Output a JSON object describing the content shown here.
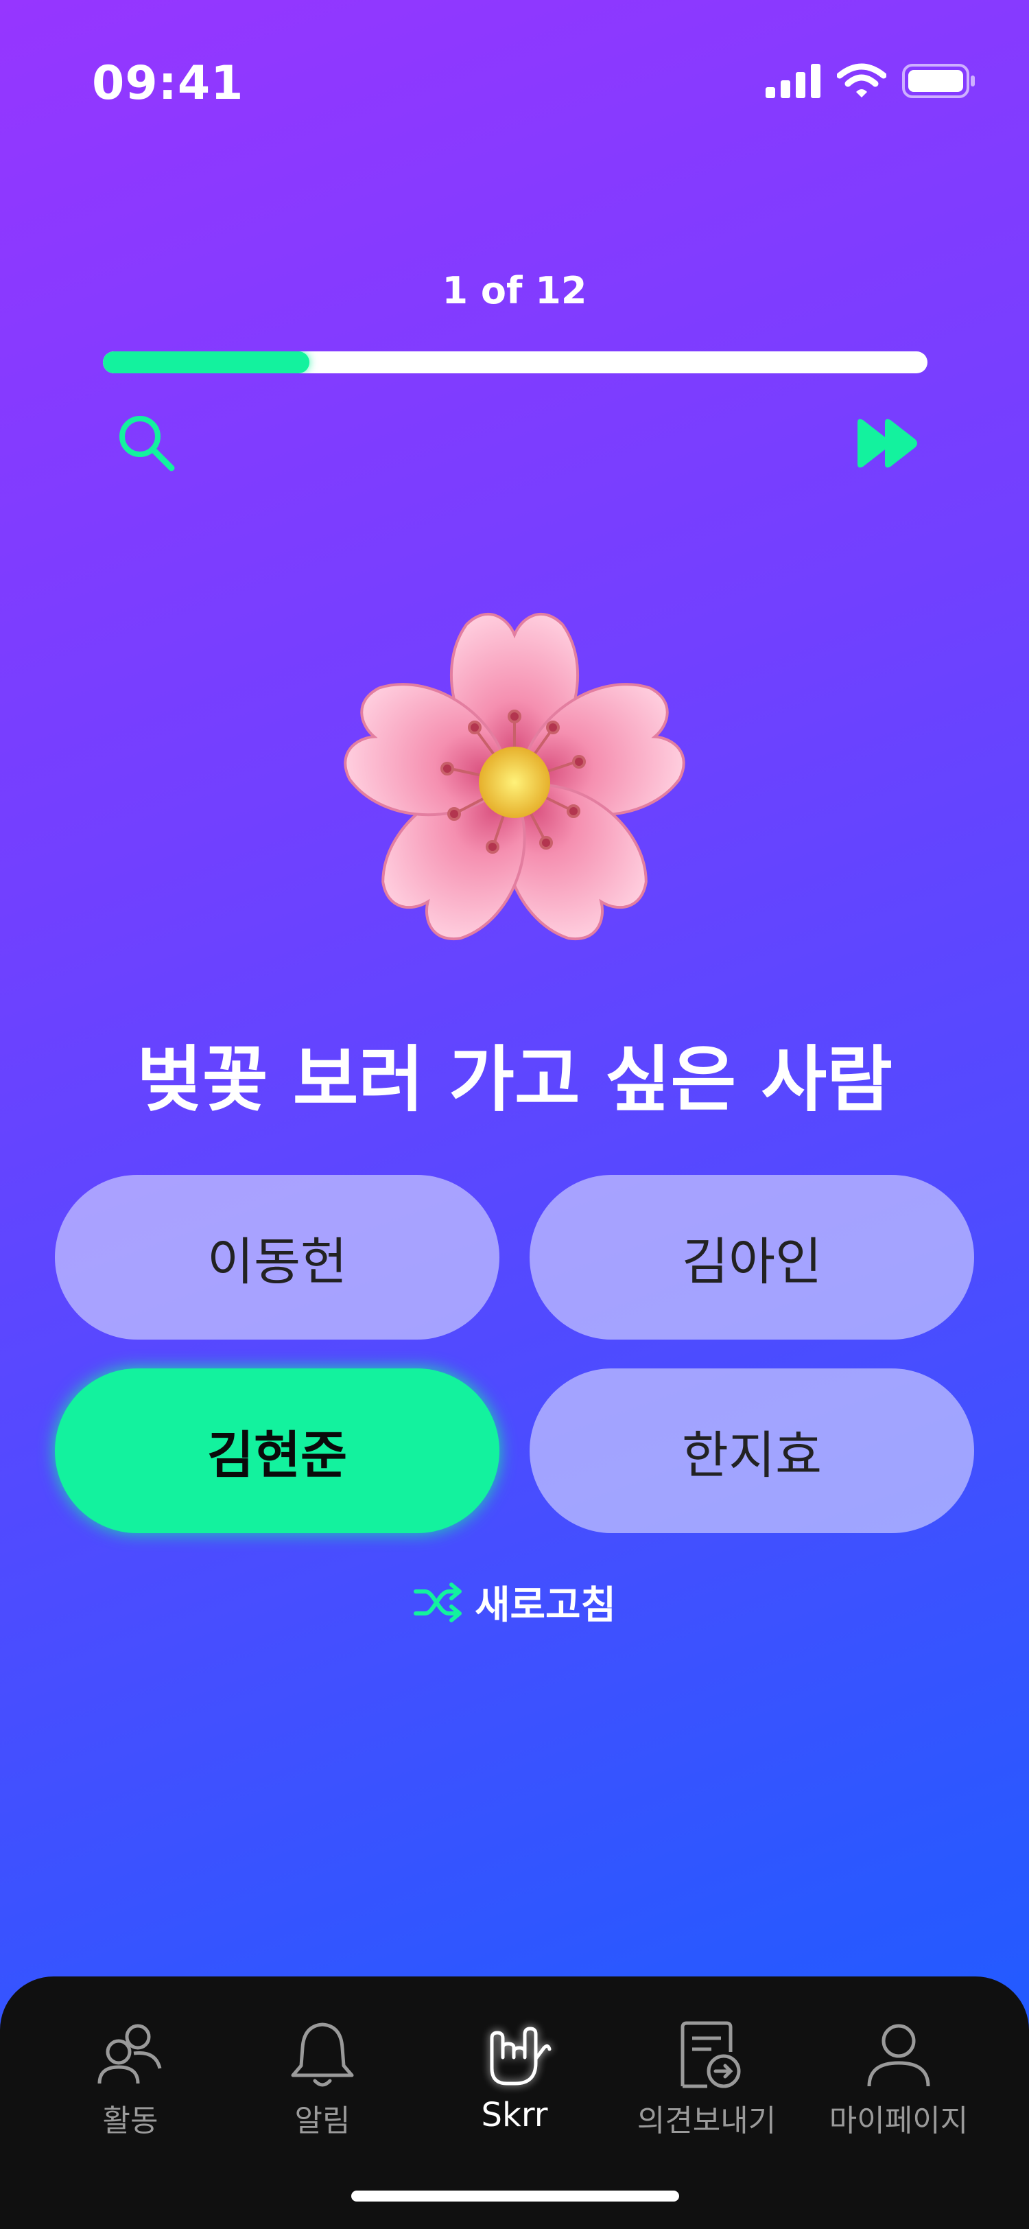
{
  "status_bar": {
    "time": "09:41",
    "icons": [
      "signal-icon",
      "wifi-icon",
      "battery-icon"
    ]
  },
  "progress": {
    "label": "1 of 12",
    "current": 1,
    "total": 12,
    "fill_fraction": 0.25,
    "track_color": "#ffffff",
    "fill_color": "#13f29e"
  },
  "toolbar": {
    "search_icon": "search-icon",
    "skip_icon": "fast-forward-icon",
    "accent_color": "#13f29e"
  },
  "question": {
    "emoji_icon": "cherry-blossom-icon",
    "text": "벚꽃 보러 가고 싶은 사람"
  },
  "options": [
    {
      "label": "이동헌",
      "selected": false
    },
    {
      "label": "김아인",
      "selected": false
    },
    {
      "label": "김현준",
      "selected": true
    },
    {
      "label": "한지효",
      "selected": false
    }
  ],
  "refresh": {
    "icon": "shuffle-icon",
    "label": "새로고침"
  },
  "tab_bar": {
    "items": [
      {
        "label": "활동",
        "icon": "people-icon",
        "active": false
      },
      {
        "label": "알림",
        "icon": "bell-icon",
        "active": false
      },
      {
        "label": "Skrr",
        "icon": "rock-hand-icon",
        "active": true
      },
      {
        "label": "의견보내기",
        "icon": "feedback-icon",
        "active": false
      },
      {
        "label": "마이페이지",
        "icon": "person-icon",
        "active": false
      }
    ]
  },
  "colors": {
    "background_top": "#9636ff",
    "background_bottom": "#1a5dff",
    "selected_option": "#13f29e",
    "tab_bar": "#101010"
  }
}
